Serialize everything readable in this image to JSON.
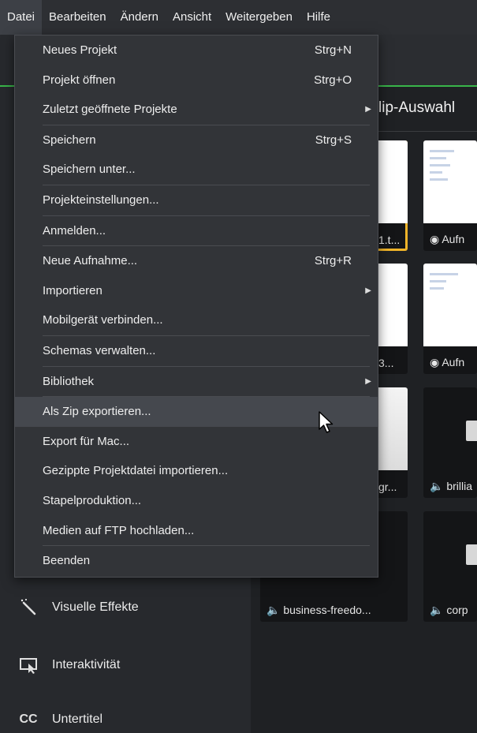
{
  "menubar": {
    "items": [
      "Datei",
      "Bearbeiten",
      "Ändern",
      "Ansicht",
      "Weitergeben",
      "Hilfe"
    ],
    "active": "Datei"
  },
  "file_menu": {
    "items": [
      {
        "label": "Neues Projekt",
        "shortcut": "Strg+N"
      },
      {
        "label": "Projekt öffnen",
        "shortcut": "Strg+O"
      },
      {
        "label": "Zuletzt geöffnete Projekte",
        "submenu": true
      },
      {
        "label": "Speichern",
        "shortcut": "Strg+S"
      },
      {
        "label": "Speichern unter..."
      },
      {
        "label": "Projekteinstellungen..."
      },
      {
        "label": "Anmelden..."
      },
      {
        "label": "Neue Aufnahme...",
        "shortcut": "Strg+R"
      },
      {
        "label": "Importieren",
        "submenu": true
      },
      {
        "label": "Mobilgerät verbinden..."
      },
      {
        "label": "Schemas verwalten..."
      },
      {
        "label": "Bibliothek",
        "submenu": true
      },
      {
        "label": "Als Zip exportieren...",
        "hovered": true
      },
      {
        "label": "Export für Mac..."
      },
      {
        "label": "Gezippte Projektdatei importieren..."
      },
      {
        "label": "Stapelproduktion..."
      },
      {
        "label": "Medien auf FTP hochladen..."
      },
      {
        "label": "Beenden"
      }
    ]
  },
  "clip_panel": {
    "title": "lip-Auswahl",
    "tiles": [
      {
        "label": "1.t..."
      },
      {
        "label": "◉ Aufn"
      },
      {
        "label": "3..."
      },
      {
        "label": "◉ Aufn"
      },
      {
        "label": "gr..."
      },
      {
        "label": "🔈 brillia"
      },
      {
        "label": "🔈 business-freedo..."
      },
      {
        "label": "🔈 corp"
      }
    ]
  },
  "sidebar": {
    "items": [
      {
        "label": "Visuelle Effekte",
        "icon": "magic-wand-icon"
      },
      {
        "label": "Interaktivität",
        "icon": "interactive-icon"
      },
      {
        "label": "Untertitel",
        "icon": "cc-icon"
      }
    ]
  },
  "colors": {
    "accent_green": "#39b54a",
    "selection_yellow": "#f0b429",
    "menu_bg": "#323438",
    "hover_bg": "#45484e"
  }
}
